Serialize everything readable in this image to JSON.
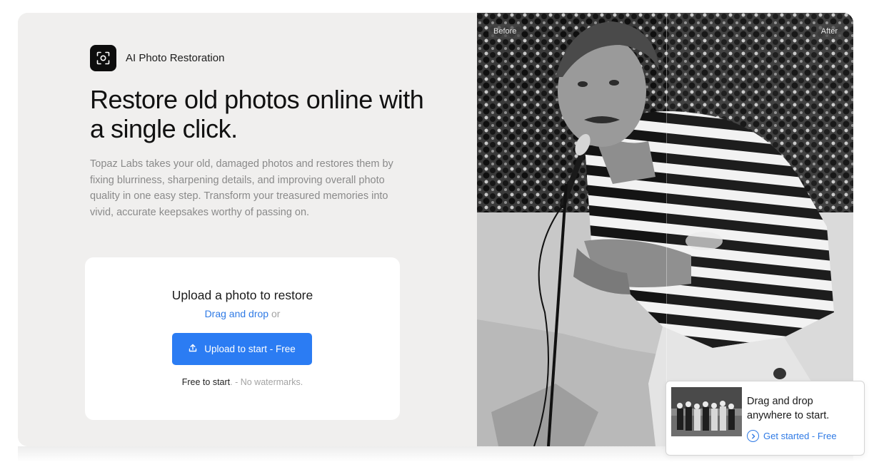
{
  "brand": {
    "icon": "scan-face-icon",
    "name": "AI Photo Restoration"
  },
  "hero": {
    "title": "Restore old photos online with a single click.",
    "description": "Topaz Labs takes your old, damaged photos and restores them by fixing blurriness, sharpening details, and improving overall photo quality in one easy step. Transform your treasured memories into vivid, accurate keepsakes worthy of passing on."
  },
  "upload": {
    "title": "Upload a photo to restore",
    "drag_drop_link": "Drag and drop",
    "or_text": "or",
    "button_label": "Upload to start - Free",
    "button_icon": "upload-icon",
    "note_primary": "Free to start",
    "note_secondary": ". - No watermarks."
  },
  "comparison": {
    "before_label": "Before",
    "after_label": "After"
  },
  "toast": {
    "title": "Drag and drop anywhere to start.",
    "cta_label": "Get started - Free",
    "cta_icon": "chevron-right-circle-icon"
  },
  "colors": {
    "accent": "#2b7cf3",
    "link": "#2f7ae5",
    "panel_bg": "#f0efee",
    "badge_bg": "#0d0d0d"
  }
}
